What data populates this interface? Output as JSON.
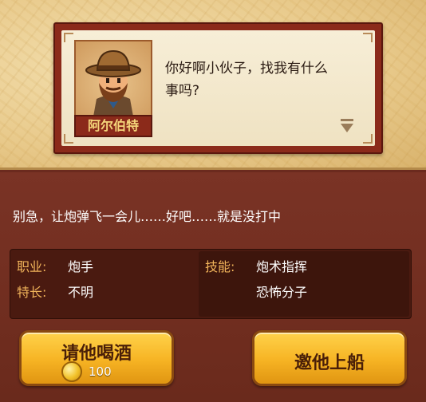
{
  "dialog": {
    "npc_name": "阿尔伯特",
    "text_line1": "你好啊小伙子，找我有什么",
    "text_line2": "事吗?"
  },
  "narration": "别急，让炮弹飞一会儿……好吧……就是没打中",
  "info": {
    "job_label": "职业:",
    "job_value": "炮手",
    "specialty_label": "特长:",
    "specialty_value": "不明",
    "skills_label": "技能:",
    "skills": [
      "炮术指挥",
      "恐怖分子"
    ]
  },
  "buttons": {
    "drink_label": "请他喝酒",
    "drink_cost": "100",
    "recruit_label": "邀他上船"
  },
  "colors": {
    "panel": "#6b2a1e",
    "label_accent": "#f0b35a",
    "button_gold": "#f6b323"
  }
}
